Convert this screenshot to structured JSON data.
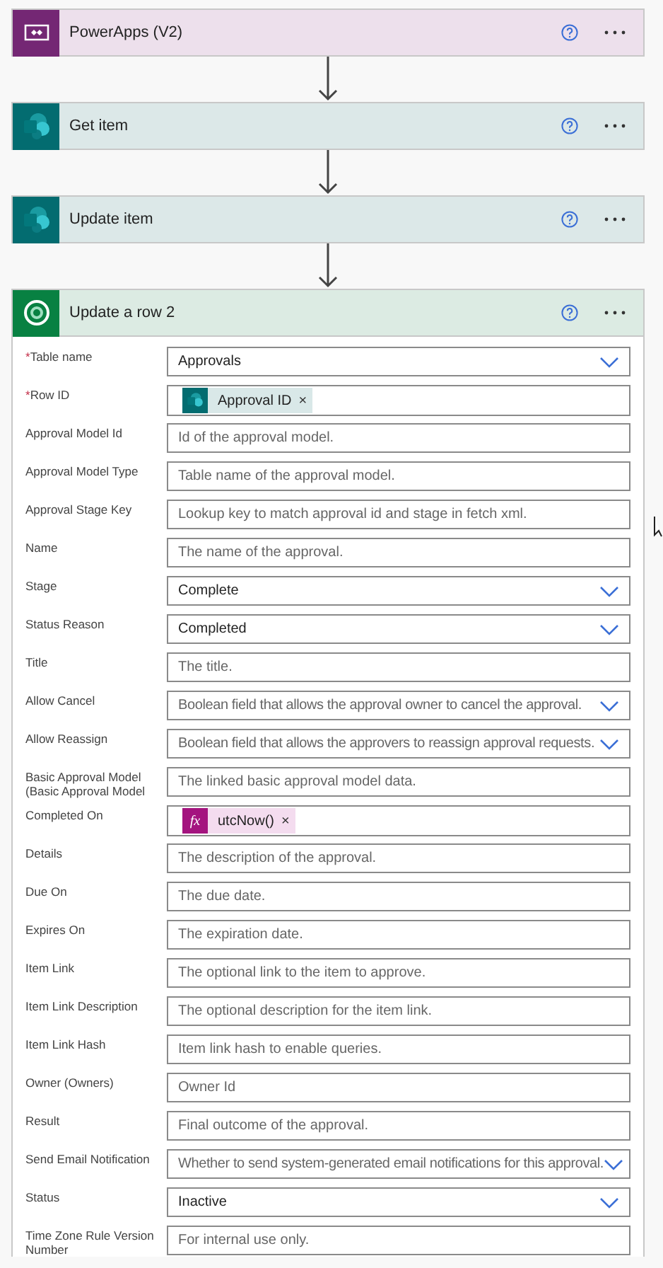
{
  "steps": [
    {
      "kind": "powerapps",
      "title": "PowerApps (V2)"
    },
    {
      "kind": "sharepoint",
      "title": "Get item"
    },
    {
      "kind": "sharepoint",
      "title": "Update item"
    },
    {
      "kind": "dataverse",
      "title": "Update a row 2",
      "expanded": true
    }
  ],
  "form": [
    {
      "label": "Table name",
      "required": true,
      "kind": "dropdown",
      "value": "Approvals"
    },
    {
      "label": "Row ID",
      "required": true,
      "kind": "token",
      "token": {
        "kind": "sharepoint",
        "text": "Approval ID",
        "remove": "×"
      }
    },
    {
      "label": "Approval Model Id",
      "required": false,
      "kind": "text",
      "placeholder": "Id of the approval model."
    },
    {
      "label": "Approval Model Type",
      "required": false,
      "kind": "text",
      "placeholder": "Table name of the approval model."
    },
    {
      "label": "Approval Stage Key",
      "required": false,
      "kind": "text",
      "placeholder": "Lookup key to match approval id and stage in fetch xml."
    },
    {
      "label": "Name",
      "required": false,
      "kind": "text",
      "placeholder": "The name of the approval."
    },
    {
      "label": "Stage",
      "required": false,
      "kind": "dropdown",
      "value": "Complete"
    },
    {
      "label": "Status Reason",
      "required": false,
      "kind": "dropdown",
      "value": "Completed"
    },
    {
      "label": "Title",
      "required": false,
      "kind": "text",
      "placeholder": "The title."
    },
    {
      "label": "Allow Cancel",
      "required": false,
      "kind": "dropdown",
      "placeholder": "Boolean field that allows the approval owner to cancel the approval."
    },
    {
      "label": "Allow Reassign",
      "required": false,
      "kind": "dropdown",
      "placeholder": "Boolean field that allows the approvers to reassign approval requests."
    },
    {
      "label": "Basic Approval Model (Basic Approval Model",
      "required": false,
      "kind": "text",
      "placeholder": "The linked basic approval model data."
    },
    {
      "label": "Completed On",
      "required": false,
      "kind": "token",
      "token": {
        "kind": "expression",
        "icon_text": "fx",
        "text": "utcNow()",
        "remove": "×"
      }
    },
    {
      "label": "Details",
      "required": false,
      "kind": "text",
      "placeholder": "The description of the approval."
    },
    {
      "label": "Due On",
      "required": false,
      "kind": "text",
      "placeholder": "The due date."
    },
    {
      "label": "Expires On",
      "required": false,
      "kind": "text",
      "placeholder": "The expiration date."
    },
    {
      "label": "Item Link",
      "required": false,
      "kind": "text",
      "placeholder": "The optional link to the item to approve."
    },
    {
      "label": "Item Link Description",
      "required": false,
      "kind": "text",
      "placeholder": "The optional description for the item link."
    },
    {
      "label": "Item Link Hash",
      "required": false,
      "kind": "text",
      "placeholder": "Item link hash to enable queries."
    },
    {
      "label": "Owner (Owners)",
      "required": false,
      "kind": "text",
      "placeholder": "Owner Id"
    },
    {
      "label": "Result",
      "required": false,
      "kind": "text",
      "placeholder": "Final outcome of the approval."
    },
    {
      "label": "Send Email Notification",
      "required": false,
      "kind": "dropdown",
      "placeholder": "Whether to send system-generated email notifications for this approval."
    },
    {
      "label": "Status",
      "required": false,
      "kind": "dropdown",
      "value": "Inactive"
    },
    {
      "label": "Time Zone Rule Version Number",
      "required": false,
      "kind": "text",
      "placeholder": "For internal use only."
    }
  ],
  "required_mark": "*"
}
